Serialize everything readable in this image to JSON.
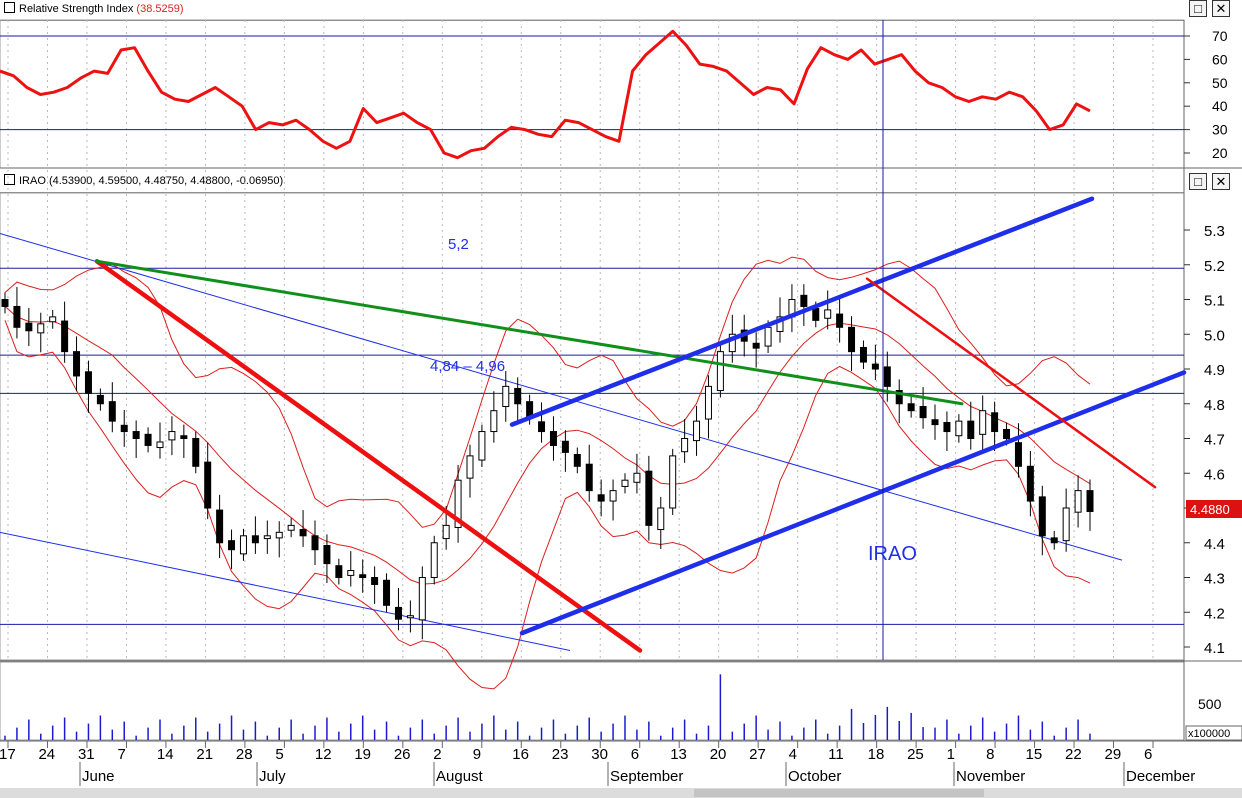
{
  "rsi_panel": {
    "title": "Relative Strength Index",
    "value": "(38.5259)",
    "yticks": [
      "70",
      "60",
      "50",
      "40",
      "30",
      "20"
    ],
    "levels": [
      70,
      30
    ]
  },
  "price_panel": {
    "title": "IRAO (4.53900, 4.59500, 4.48750, 4.48800, -0.06950)",
    "yticks": [
      "5.3",
      "5.2",
      "5.1",
      "5.0",
      "4.9",
      "4.8",
      "4.7",
      "4.6",
      "4.5",
      "4.4",
      "4.3",
      "4.2",
      "4.1"
    ],
    "last_price": "4.4880",
    "annotations": [
      "5,2",
      "4,84 – 4,96",
      "IRAO"
    ],
    "horizontal_levels": [
      5.19,
      4.94,
      4.83,
      4.165
    ]
  },
  "volume_panel": {
    "ytick": "500",
    "multiplier": "x100000"
  },
  "xaxis": {
    "days": [
      "17",
      "24",
      "31",
      "7",
      "14",
      "21",
      "28",
      "5",
      "12",
      "19",
      "26",
      "2",
      "9",
      "16",
      "23",
      "30",
      "6",
      "13",
      "20",
      "27",
      "4",
      "11",
      "18",
      "25",
      "1",
      "8",
      "15",
      "22",
      "29",
      "6"
    ],
    "months": [
      "June",
      "July",
      "August",
      "September",
      "October",
      "November",
      "December"
    ]
  },
  "window_buttons": {
    "maximize": "□",
    "close": "✕"
  },
  "colors": {
    "rsi_line": "#ee1111",
    "bands": "#dd1f1f",
    "trend_blue": "#1f2ee8",
    "trend_red": "#ee1010",
    "trend_green": "#10901a",
    "level_lines": "#1a1aa0",
    "last_price_bg": "#dd1111"
  },
  "chart_data": {
    "type": "candlestick",
    "ticker": "IRAO",
    "x_categories": [
      "17",
      "24",
      "31",
      "7",
      "14",
      "21",
      "28",
      "5",
      "12",
      "19",
      "26",
      "2",
      "9",
      "16",
      "23",
      "30",
      "6",
      "13",
      "20",
      "27",
      "4",
      "11",
      "18",
      "25",
      "1",
      "8",
      "15",
      "22",
      "29",
      "6"
    ],
    "ylim_price": [
      4.05,
      5.4
    ],
    "ylim_rsi": [
      15,
      75
    ],
    "closes_approx": [
      5.08,
      5.02,
      5.01,
      5.03,
      5.05,
      4.95,
      4.88,
      4.83,
      4.8,
      4.75,
      4.72,
      4.7,
      4.68,
      4.69,
      4.72,
      4.7,
      4.62,
      4.5,
      4.4,
      4.38,
      4.42,
      4.4,
      4.42,
      4.43,
      4.45,
      4.42,
      4.38,
      4.34,
      4.3,
      4.32,
      4.3,
      4.28,
      4.22,
      4.18,
      4.19,
      4.3,
      4.4,
      4.45,
      4.58,
      4.65,
      4.72,
      4.78,
      4.85,
      4.8,
      4.76,
      4.72,
      4.68,
      4.66,
      4.62,
      4.55,
      4.52,
      4.55,
      4.58,
      4.6,
      4.45,
      4.5,
      4.65,
      4.7,
      4.75,
      4.85,
      4.95,
      5.0,
      4.98,
      4.96,
      5.02,
      5.05,
      5.1,
      5.08,
      5.04,
      5.07,
      5.02,
      4.95,
      4.92,
      4.9,
      4.85,
      4.8,
      4.78,
      4.76,
      4.74,
      4.72,
      4.75,
      4.7,
      4.78,
      4.72,
      4.7,
      4.62,
      4.52,
      4.42,
      4.4,
      4.5,
      4.55,
      4.49
    ],
    "rsi_approx": [
      55,
      53,
      48,
      45,
      46,
      48,
      52,
      55,
      54,
      64,
      65,
      55,
      46,
      43,
      42,
      45,
      48,
      44,
      40,
      30,
      33,
      32,
      34,
      30,
      25,
      22,
      25,
      39,
      33,
      35,
      37,
      33,
      30,
      20,
      18,
      21,
      22,
      27,
      31,
      30,
      28,
      27,
      34,
      33,
      30,
      27,
      25,
      55,
      62,
      67,
      72,
      66,
      58,
      57,
      55,
      50,
      45,
      48,
      47,
      41,
      56,
      65,
      62,
      60,
      64,
      58,
      60,
      62,
      55,
      50,
      48,
      44,
      42,
      44,
      43,
      46,
      44,
      38,
      30,
      32,
      41,
      38
    ],
    "volume_ytick": 500
  }
}
